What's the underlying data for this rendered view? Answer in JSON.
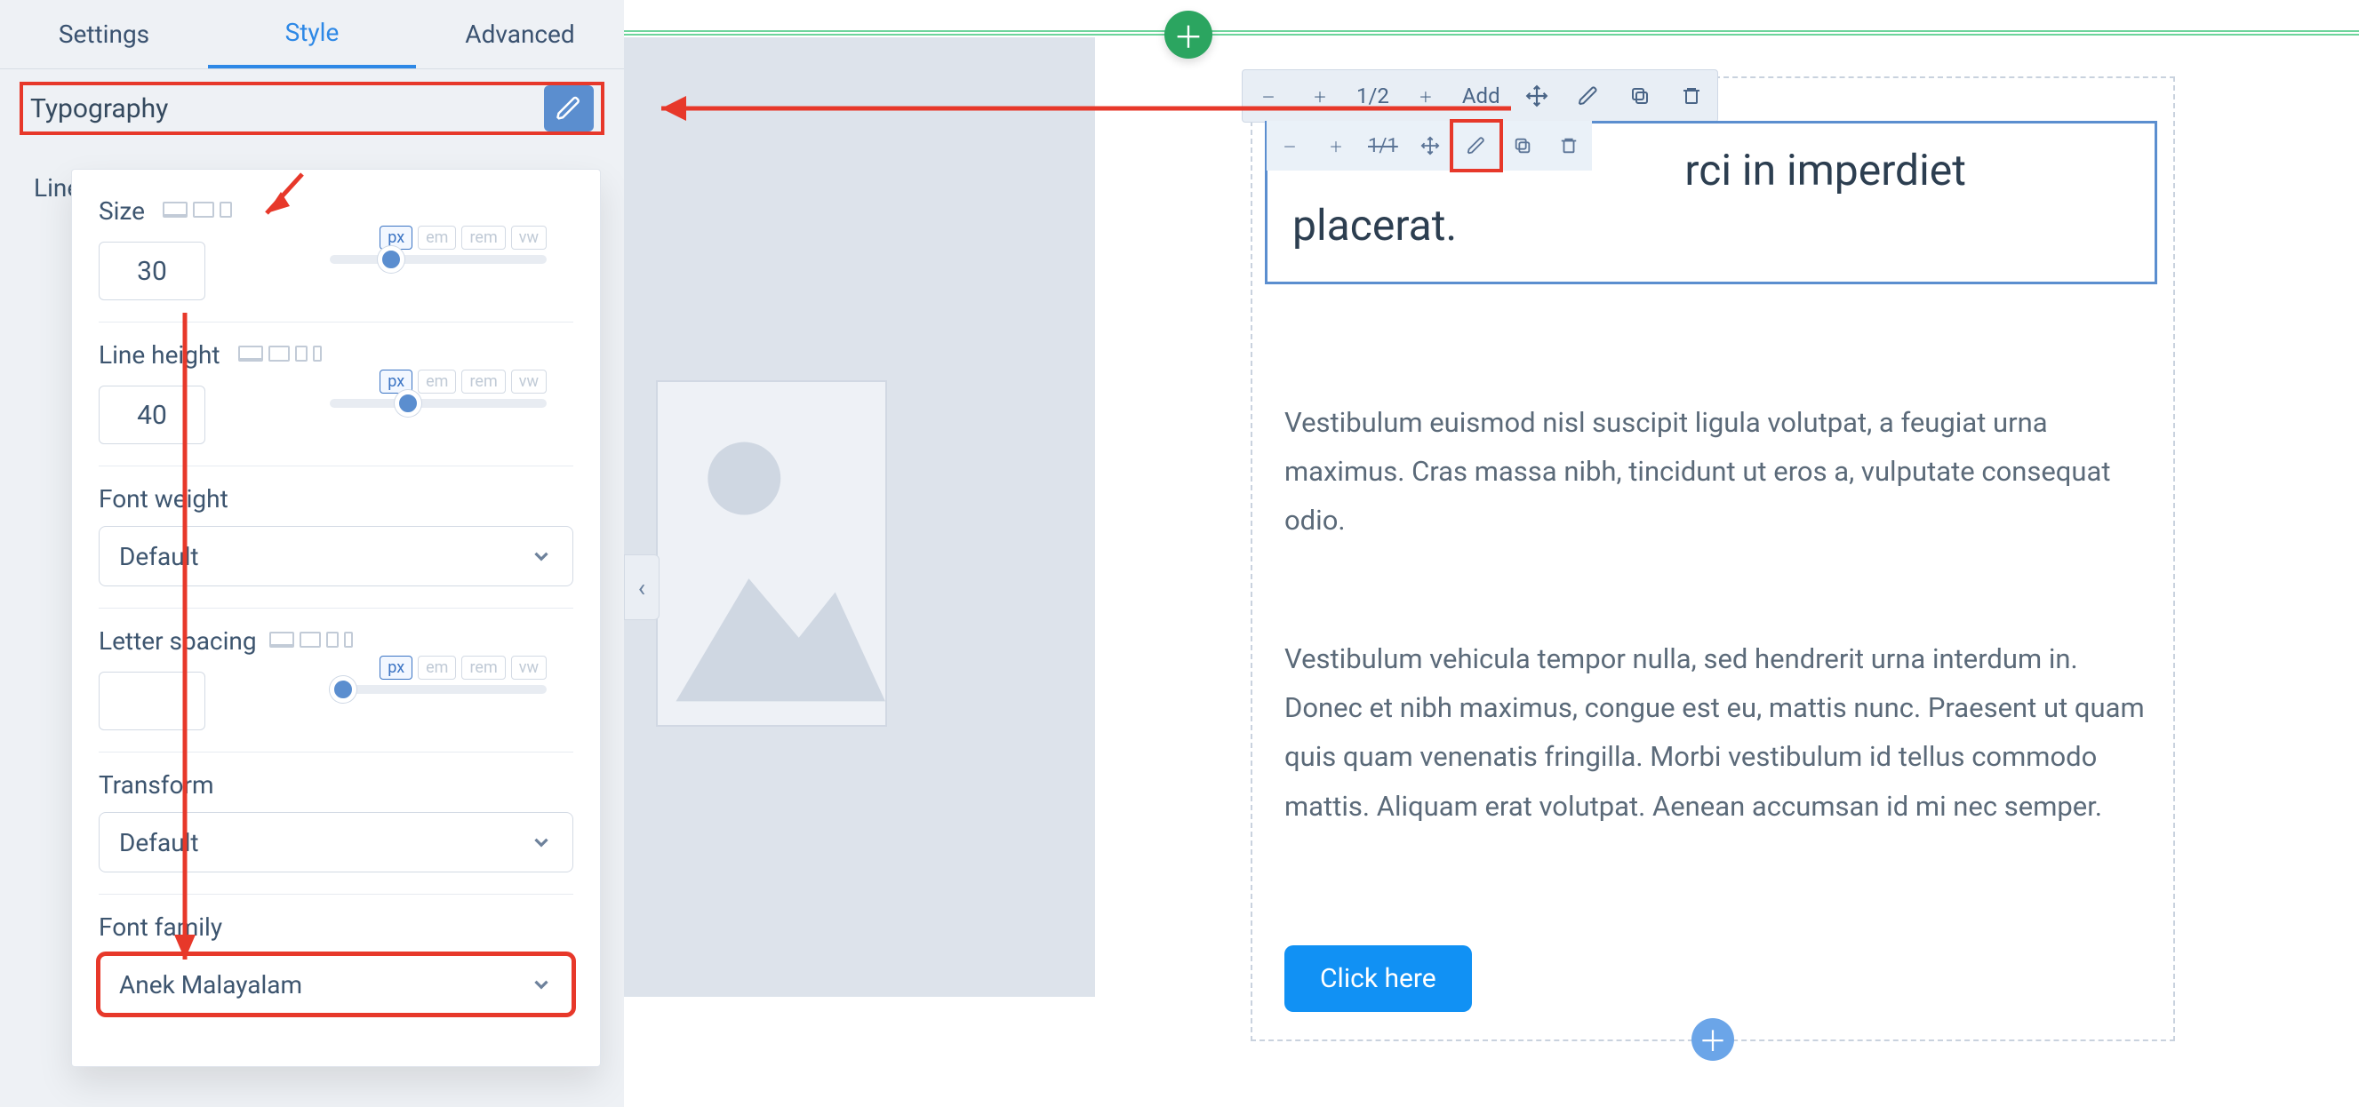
{
  "tabs": {
    "settings": "Settings",
    "style": "Style",
    "advanced": "Advanced"
  },
  "section": {
    "typography": "Typography"
  },
  "side_label": "Line",
  "typo": {
    "size": {
      "label": "Size",
      "value": "30",
      "unit": "px",
      "units": [
        "px",
        "em",
        "rem",
        "vw"
      ],
      "slider": 22
    },
    "lh": {
      "label": "Line height",
      "value": "40",
      "unit": "px",
      "units": [
        "px",
        "em",
        "rem",
        "vw"
      ],
      "slider": 30
    },
    "weight": {
      "label": "Font weight",
      "value": "Default"
    },
    "ls": {
      "label": "Letter spacing",
      "value": "",
      "unit": "px",
      "units": [
        "px",
        "em",
        "rem",
        "vw"
      ],
      "slider": 0
    },
    "tf": {
      "label": "Transform",
      "value": "Default"
    },
    "ff": {
      "label": "Font family",
      "value": "Anek Malayalam"
    }
  },
  "toolbar_outer": {
    "ratio": "1/2",
    "add": "Add"
  },
  "toolbar_inner": {
    "ratio": "1/1"
  },
  "content": {
    "heading_fragment": "rci in imperdiet placerat.",
    "p1": "Vestibulum euismod nisl suscipit ligula volutpat, a feugiat urna maximus. Cras massa nibh, tincidunt ut eros a, vulputate consequat odio.",
    "p2": "Vestibulum vehicula tempor nulla, sed hendrerit urna interdum in. Donec et nibh maximus, congue est eu, mattis nunc. Praesent ut quam quis quam venenatis fringilla. Morbi vestibulum id tellus commodo mattis. Aliquam erat volutpat. Aenean accumsan id mi nec semper.",
    "cta": "Click here"
  }
}
